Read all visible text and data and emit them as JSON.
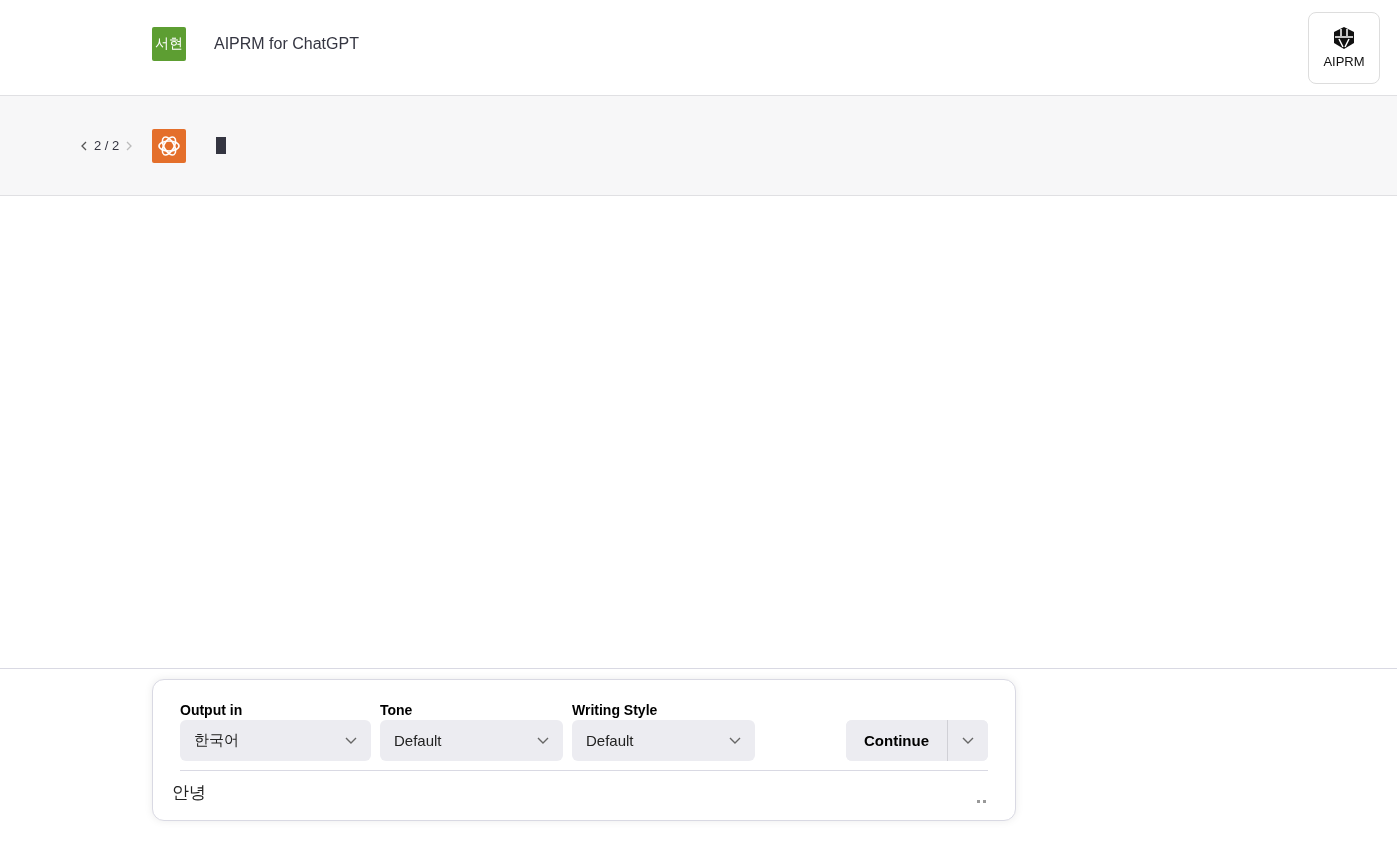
{
  "user_message": {
    "avatar": "서현",
    "text": "AIPRM for ChatGPT"
  },
  "aiprm_badge": {
    "label": "AIPRM"
  },
  "assistant_message": {
    "pager": "2 / 2",
    "streaming": true
  },
  "prompt_panel": {
    "selects": [
      {
        "label": "Output in",
        "value": "한국어"
      },
      {
        "label": "Tone",
        "value": "Default"
      },
      {
        "label": "Writing Style",
        "value": "Default"
      }
    ],
    "continue_button": "Continue",
    "input": {
      "value": "안녕"
    }
  }
}
